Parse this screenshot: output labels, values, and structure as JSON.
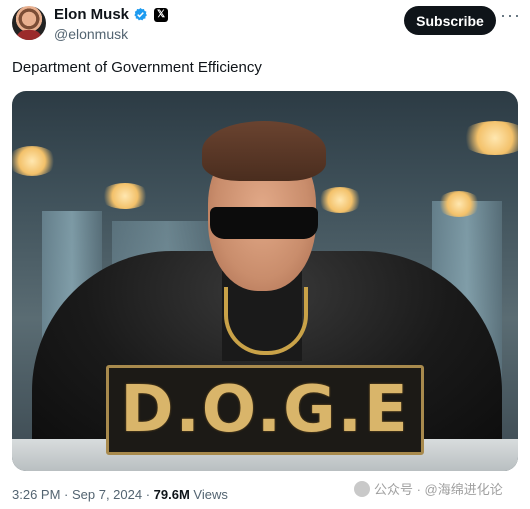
{
  "author": {
    "name": "Elon Musk",
    "handle": "@elonmusk",
    "verified_icon": "verified-badge-icon",
    "affiliate_icon": "x-logo-icon"
  },
  "actions": {
    "subscribe_label": "Subscribe",
    "more_label": "···"
  },
  "tweet": {
    "text": "Department of Government Efficiency",
    "media": {
      "plaque_text": "D.O.G.E"
    }
  },
  "meta": {
    "time": "3:26 PM",
    "sep1": " · ",
    "date": "Sep 7, 2024",
    "sep2": " · ",
    "views_count": "79.6M",
    "views_label": " Views"
  },
  "watermark": {
    "text": "公众号 · @海绵进化论"
  },
  "colors": {
    "text": "#0f1419",
    "secondary": "#536471",
    "verified": "#1d9bf0",
    "button": "#0f1419"
  }
}
